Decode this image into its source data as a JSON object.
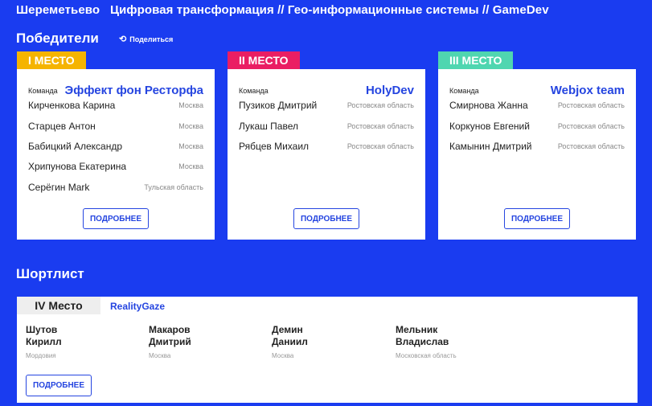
{
  "header": {
    "breadcrumb": "Шереметьево   Цифровая трансформация // Гео-информационные системы // GameDev"
  },
  "winners": {
    "title": "Победители",
    "share_label": "Поделиться"
  },
  "cards": [
    {
      "place": "I МЕСТО",
      "badge_color": "#f5b400",
      "team_label": "Команда",
      "team_name": "Эффект фон Ресторфа",
      "members": [
        {
          "name": "Кирченкова Карина",
          "region": "Москва"
        },
        {
          "name": "Старцев Антон",
          "region": "Москва"
        },
        {
          "name": "Бабицкий Александр",
          "region": "Москва"
        },
        {
          "name": "Хрипунова Екатерина",
          "region": "Москва"
        },
        {
          "name": "Серёгин Mark",
          "region": "Тульская область"
        }
      ],
      "button": "ПОДРОБНЕЕ"
    },
    {
      "place": "II МЕСТО",
      "badge_color": "#ea1e63",
      "team_label": "Команда",
      "team_name": "HolyDev",
      "members": [
        {
          "name": "Пузиков Дмитрий",
          "region": "Ростовская область"
        },
        {
          "name": "Лукаш Павел",
          "region": "Ростовская область"
        },
        {
          "name": "Рябцев Михаил",
          "region": "Ростовская область"
        }
      ],
      "button": "ПОДРОБНЕЕ"
    },
    {
      "place": "III МЕСТО",
      "badge_color": "#4fd6b0",
      "team_label": "Команда",
      "team_name": "Webjox team",
      "members": [
        {
          "name": "Смирнова Жанна",
          "region": "Ростовская область"
        },
        {
          "name": "Коркунов Евгений",
          "region": "Ростовская область"
        },
        {
          "name": "Камынин Дмитрий",
          "region": "Ростовская область"
        }
      ],
      "button": "ПОДРОБНЕЕ"
    }
  ],
  "shortlist": {
    "title": "Шортлист",
    "place": "IV Место",
    "team_name": "RealityGaze",
    "members": [
      {
        "first": "Шутов",
        "second": "Кирилл",
        "region": "Мордовия"
      },
      {
        "first": "Макаров",
        "second": "Дмитрий",
        "region": "Москва"
      },
      {
        "first": "Демин",
        "second": "Даниил",
        "region": "Москва"
      },
      {
        "first": "Мельник",
        "second": "Владислав",
        "region": "Московская область"
      }
    ],
    "button": "ПОДРОБНЕЕ"
  }
}
